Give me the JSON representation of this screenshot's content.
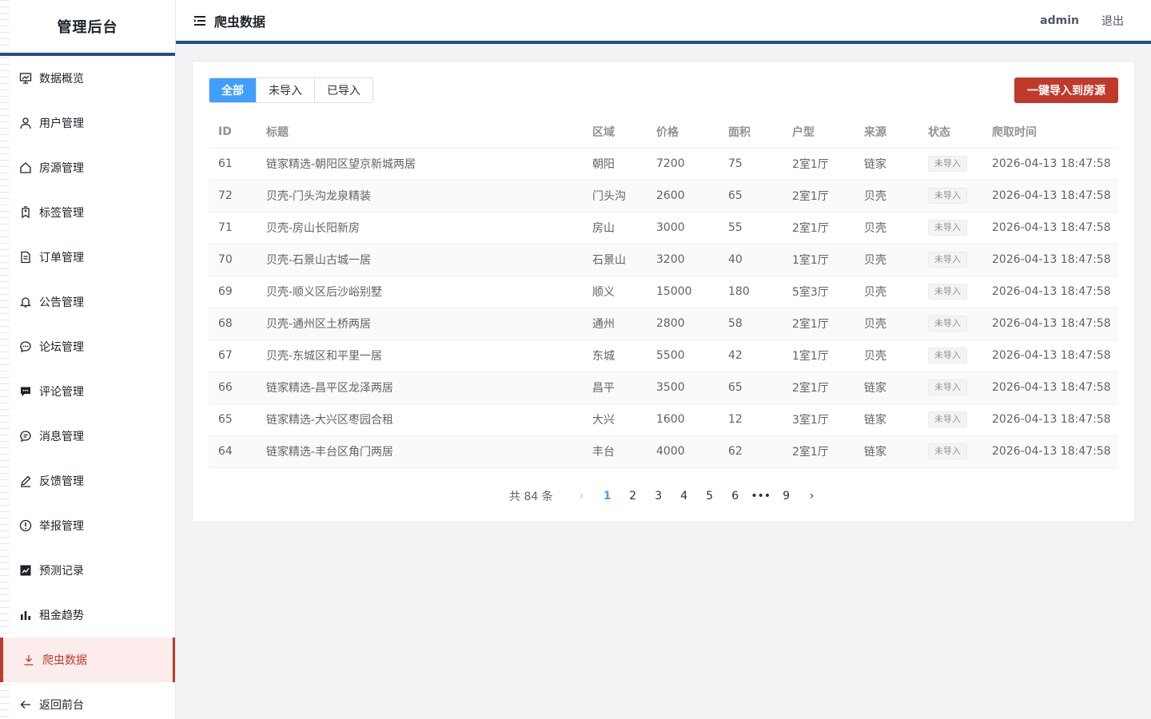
{
  "sidebar": {
    "brand": "管理后台",
    "items": [
      {
        "label": "数据概览",
        "icon": "dashboard-icon"
      },
      {
        "label": "用户管理",
        "icon": "user-icon"
      },
      {
        "label": "房源管理",
        "icon": "house-icon"
      },
      {
        "label": "标签管理",
        "icon": "tag-icon"
      },
      {
        "label": "订单管理",
        "icon": "document-icon"
      },
      {
        "label": "公告管理",
        "icon": "bell-icon"
      },
      {
        "label": "论坛管理",
        "icon": "chat-dots-icon"
      },
      {
        "label": "评论管理",
        "icon": "comment-icon"
      },
      {
        "label": "消息管理",
        "icon": "message-icon"
      },
      {
        "label": "反馈管理",
        "icon": "edit-pen-icon"
      },
      {
        "label": "举报管理",
        "icon": "warning-icon"
      },
      {
        "label": "预测记录",
        "icon": "trend-chart-icon"
      },
      {
        "label": "租金趋势",
        "icon": "bar-chart-icon"
      },
      {
        "label": "爬虫数据",
        "icon": "download-icon",
        "active": true
      },
      {
        "label": "返回前台",
        "icon": "arrow-left-icon"
      }
    ]
  },
  "header": {
    "title": "爬虫数据",
    "user": "admin",
    "logout": "退出"
  },
  "filter": {
    "all": "全部",
    "not_imported": "未导入",
    "imported": "已导入",
    "selected": "全部"
  },
  "import_button": "一键导入到房源",
  "table": {
    "columns": [
      "ID",
      "标题",
      "区域",
      "价格",
      "面积",
      "户型",
      "来源",
      "状态",
      "爬取时间"
    ],
    "rows": [
      [
        "61",
        "链家精选-朝阳区望京新城两居",
        "朝阳",
        "7200",
        "75",
        "2室1厅",
        "链家",
        "未导入",
        "2026-04-13 18:47:58"
      ],
      [
        "72",
        "贝壳-门头沟龙泉精装",
        "门头沟",
        "2600",
        "65",
        "2室1厅",
        "贝壳",
        "未导入",
        "2026-04-13 18:47:58"
      ],
      [
        "71",
        "贝壳-房山长阳新房",
        "房山",
        "3000",
        "55",
        "2室1厅",
        "贝壳",
        "未导入",
        "2026-04-13 18:47:58"
      ],
      [
        "70",
        "贝壳-石景山古城一居",
        "石景山",
        "3200",
        "40",
        "1室1厅",
        "贝壳",
        "未导入",
        "2026-04-13 18:47:58"
      ],
      [
        "69",
        "贝壳-顺义区后沙峪别墅",
        "顺义",
        "15000",
        "180",
        "5室3厅",
        "贝壳",
        "未导入",
        "2026-04-13 18:47:58"
      ],
      [
        "68",
        "贝壳-通州区土桥两居",
        "通州",
        "2800",
        "58",
        "2室1厅",
        "贝壳",
        "未导入",
        "2026-04-13 18:47:58"
      ],
      [
        "67",
        "贝壳-东城区和平里一居",
        "东城",
        "5500",
        "42",
        "1室1厅",
        "贝壳",
        "未导入",
        "2026-04-13 18:47:58"
      ],
      [
        "66",
        "链家精选-昌平区龙泽两居",
        "昌平",
        "3500",
        "65",
        "2室1厅",
        "链家",
        "未导入",
        "2026-04-13 18:47:58"
      ],
      [
        "65",
        "链家精选-大兴区枣园合租",
        "大兴",
        "1600",
        "12",
        "3室1厅",
        "链家",
        "未导入",
        "2026-04-13 18:47:58"
      ],
      [
        "64",
        "链家精选-丰台区角门两居",
        "丰台",
        "4000",
        "62",
        "2室1厅",
        "链家",
        "未导入",
        "2026-04-13 18:47:58"
      ]
    ]
  },
  "pagination": {
    "total": "共 84 条",
    "current": "1",
    "pages": [
      "1",
      "2",
      "3",
      "4",
      "5",
      "6",
      "•••",
      "9"
    ],
    "prev": "‹",
    "next": "›"
  }
}
